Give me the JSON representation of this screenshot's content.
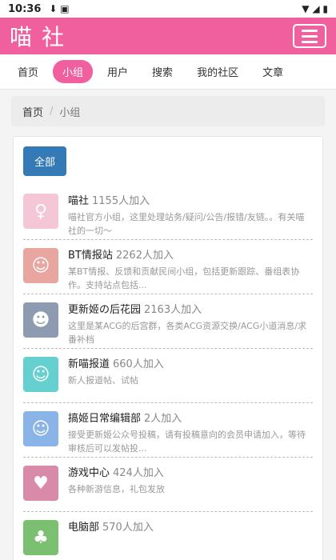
{
  "status_bar": {
    "time": "10:36",
    "notif_icons": "⬇ ▣",
    "right_icons": "▼ ◢ ▮"
  },
  "header": {
    "logo": "喵社"
  },
  "nav": {
    "tabs": [
      "首页",
      "小组",
      "用户",
      "搜索",
      "我的社区",
      "文章"
    ],
    "active": "小组"
  },
  "breadcrumb": {
    "home": "首页",
    "separator": "/",
    "current": "小组"
  },
  "all_button": "全部",
  "groups": [
    {
      "title": "喵社",
      "count": "1155人加入",
      "desc": "喵社官方小组，这里处理站务/疑问/公告/报错/友链。。有关喵社的一切～",
      "color": "#f4c6d6",
      "icon": "♀"
    },
    {
      "title": "BT情报站",
      "count": "2262人加入",
      "desc": "某BT情报、反馈和贡献民间小组，包括更新跟踪、番组表协作。支持站点包括...",
      "color": "#e9a6a0",
      "icon": "☺"
    },
    {
      "title": "更新姬の后花园",
      "count": "2163人加入",
      "desc": "这里是某ACG的后宫群，各类ACG资源交换/ACG小道消息/求番补档",
      "color": "#8e9ab0",
      "icon": "☻"
    },
    {
      "title": "新喵报道",
      "count": "660人加入",
      "desc": "新人报道帖、试帖",
      "color": "#66cfcf",
      "icon": "☺"
    },
    {
      "title": "搞姬日常编辑部",
      "count": "2人加入",
      "desc": "接受更新姬公众号投稿，请有投稿意向的会员申请加入，等待审核后可以发帖投...",
      "color": "#8ab4e8",
      "icon": "☺"
    },
    {
      "title": "游戏中心",
      "count": "424人加入",
      "desc": "各种新游信息，礼包发放",
      "color": "#d88aa8",
      "icon": "♥"
    },
    {
      "title": "电脑部",
      "count": "570人加入",
      "desc": "",
      "color": "#7ac070",
      "icon": "♣"
    }
  ]
}
